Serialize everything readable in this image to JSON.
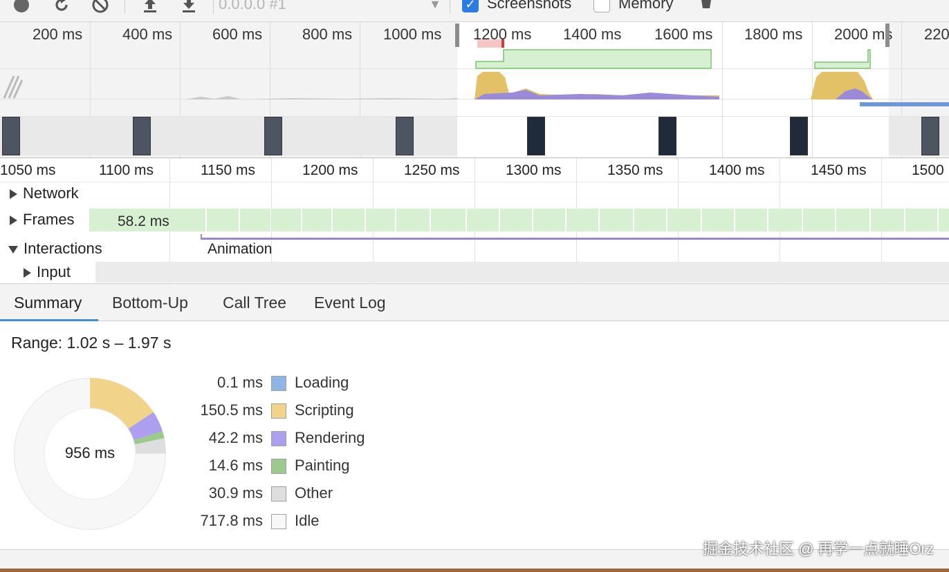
{
  "toolbar": {
    "icons": [
      "record-icon",
      "reload-icon",
      "clear-icon",
      "upload-icon",
      "download-icon"
    ],
    "profile_select": "0.0.0.0 #1",
    "screenshots_label": "Screenshots",
    "memory_label": "Memory",
    "screenshots_checked": true,
    "memory_checked": false
  },
  "overview": {
    "ticks": [
      "200 ms",
      "400 ms",
      "600 ms",
      "800 ms",
      "1000 ms",
      "1200 ms",
      "1400 ms",
      "1600 ms",
      "1800 ms",
      "2000 ms",
      "220"
    ]
  },
  "timeline": {
    "ticks": [
      "1050 ms",
      "1100 ms",
      "1150 ms",
      "1200 ms",
      "1250 ms",
      "1300 ms",
      "1350 ms",
      "1400 ms",
      "1450 ms",
      "1500"
    ],
    "tracks": {
      "network": "Network",
      "frames": "Frames",
      "interactions": "Interactions",
      "input": "Input"
    },
    "frame_duration": "58.2 ms",
    "animation_label": "Animation"
  },
  "tabs": [
    "Summary",
    "Bottom-Up",
    "Call Tree",
    "Event Log"
  ],
  "summary": {
    "range_label": "Range: 1.02 s – 1.97 s",
    "total": "956 ms",
    "categories": [
      {
        "value": "0.1 ms",
        "name": "Loading",
        "color": "#8fb4e6",
        "ms": 0.1
      },
      {
        "value": "150.5 ms",
        "name": "Scripting",
        "color": "#f1d38a",
        "ms": 150.5
      },
      {
        "value": "42.2 ms",
        "name": "Rendering",
        "color": "#ad9ff0",
        "ms": 42.2
      },
      {
        "value": "14.6 ms",
        "name": "Painting",
        "color": "#9bca8c",
        "ms": 14.6
      },
      {
        "value": "30.9 ms",
        "name": "Other",
        "color": "#dedede",
        "ms": 30.9
      },
      {
        "value": "717.8 ms",
        "name": "Idle",
        "color": "#f7f7f7",
        "ms": 717.8
      }
    ]
  },
  "watermark": "掘金技术社区 @ 再学一点就睡Orz"
}
